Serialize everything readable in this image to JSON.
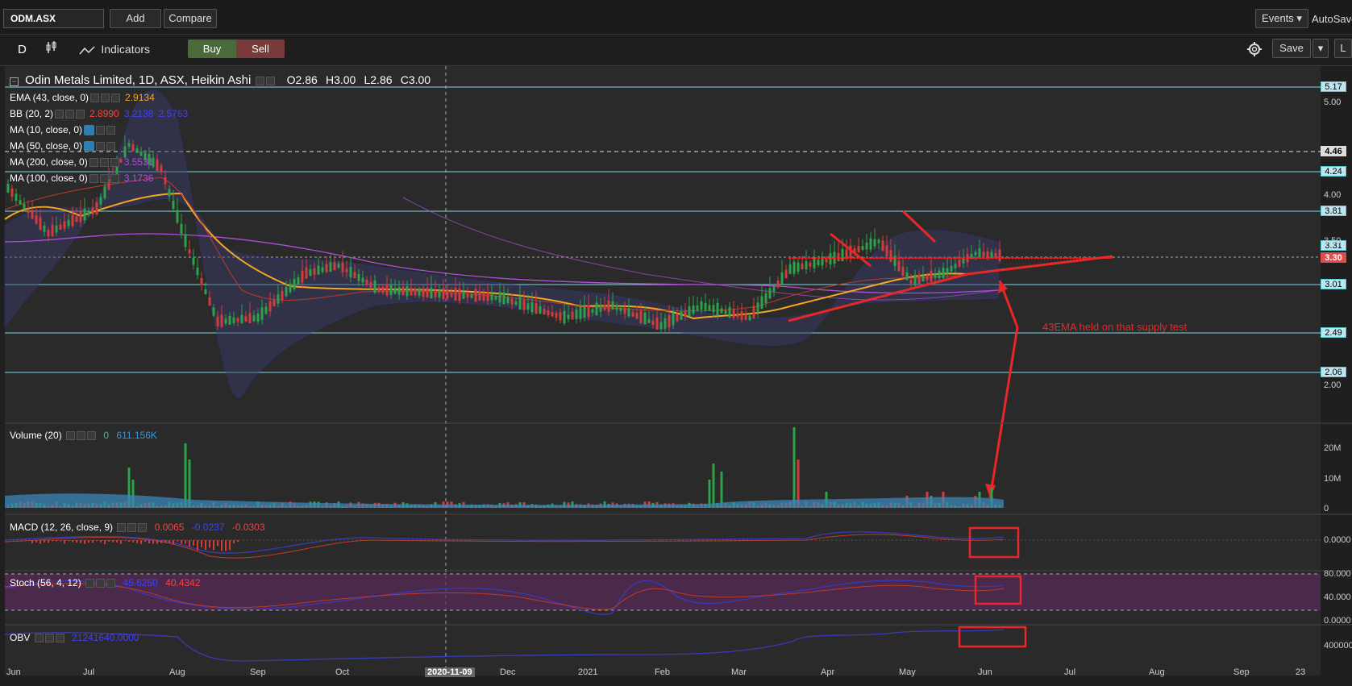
{
  "toolbar": {
    "symbol": "ODM.ASX",
    "add_label": "Add",
    "compare_label": "Compare",
    "events_label": "Events ▾",
    "autosave_label": "AutoSave",
    "interval_label": "D",
    "indicators_label": "Indicators",
    "buy_label": "Buy",
    "sell_label": "Sell",
    "save_label": "Save",
    "layout_label": "L"
  },
  "main_legend": {
    "title": "Odin Metals Limited, 1D, ASX, Heikin Ashi",
    "open": "O2.86",
    "high": "H3.00",
    "low": "L2.86",
    "close": "C3.00"
  },
  "indicators": [
    {
      "name": "EMA (43, close, 0)",
      "values": [
        "2.9134"
      ],
      "colors": [
        "#f5a623"
      ]
    },
    {
      "name": "BB (20, 2)",
      "values": [
        "2.8990",
        "3.2138",
        "2.5763"
      ],
      "colors": [
        "#ff4040",
        "#4040ff",
        "#4040ff"
      ]
    },
    {
      "name": "MA (10, close, 0)",
      "values": [],
      "colors": []
    },
    {
      "name": "MA (50, close, 0)",
      "values": [],
      "colors": []
    },
    {
      "name": "MA (200, close, 0)",
      "values": [
        "3.5531"
      ],
      "colors": [
        "#b04fd8"
      ]
    },
    {
      "name": "MA (100, close, 0)",
      "values": [
        "3.1736"
      ],
      "colors": [
        "#b04fd8"
      ]
    }
  ],
  "price_axis": {
    "tags": [
      {
        "label": "5.17",
        "type": "line"
      },
      {
        "label": "4.46",
        "type": "dash"
      },
      {
        "label": "4.24",
        "type": "line"
      },
      {
        "label": "3.81",
        "type": "line"
      },
      {
        "label": "3.31",
        "type": "line"
      },
      {
        "label": "3.30",
        "type": "current"
      },
      {
        "label": "3.01",
        "type": "line"
      },
      {
        "label": "2.49",
        "type": "line"
      },
      {
        "label": "2.06",
        "type": "line"
      }
    ],
    "ticks": [
      "5.00",
      "4.00",
      "3.50",
      "2.00"
    ]
  },
  "volume": {
    "name": "Volume (20)",
    "values": [
      "0",
      "611.156K"
    ],
    "colors": [
      "#2ecc71",
      "#3498db"
    ],
    "axis": [
      "20M",
      "10M",
      "0"
    ]
  },
  "macd": {
    "name": "MACD (12, 26, close, 9)",
    "values": [
      "0.0065",
      "-0.0237",
      "-0.0303"
    ],
    "axis": [
      "0.0000"
    ]
  },
  "stoch": {
    "name": "Stoch (56, 4, 12)",
    "values": [
      "45.6250",
      "40.4342"
    ],
    "axis": [
      "80.000",
      "40.000",
      "0.0000"
    ]
  },
  "obv": {
    "name": "OBV",
    "values": [
      "21241640.0000"
    ],
    "axis": [
      "400000"
    ]
  },
  "annotation": {
    "text": "43EMA held on that supply test",
    "color": "#e82828"
  },
  "x_axis": {
    "labels": [
      "Jun",
      "Jul",
      "Aug",
      "Sep",
      "Oct",
      "2020-11-09",
      "Dec",
      "2021",
      "Feb",
      "Mar",
      "Apr",
      "May",
      "Jun",
      "Jul",
      "Aug",
      "Sep",
      "23"
    ],
    "crosshair_date": "2020-11-09"
  },
  "colors": {
    "background": "#2a2a2a",
    "level_line": "#7fd6e6",
    "up_candle": "#2ca24a",
    "down_candle": "#d23c3c",
    "ema": "#f5a623",
    "bb": "#3a3ab8",
    "ma_purple": "#b04fd8",
    "buy": "#4a6a3a",
    "sell": "#7a3a3a"
  }
}
